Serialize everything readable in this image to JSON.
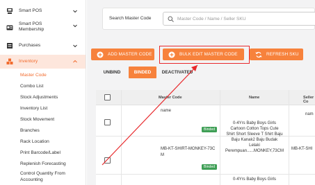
{
  "sidebar": {
    "items": [
      {
        "label": "Smart POS",
        "icon": "pos-terminal-icon"
      },
      {
        "label": "Smart POS Membership",
        "label_line1": "Smart POS",
        "label_line2": "Membership",
        "icon": "membership-card-icon"
      },
      {
        "label": "Purchases",
        "icon": "purchases-icon"
      },
      {
        "label": "Inventory",
        "icon": "inventory-boxes-icon"
      }
    ],
    "inventory_subitems": [
      "Master Code",
      "Combo List",
      "Stock Adjustments",
      "Inventory List",
      "Stock Movement",
      "Branches",
      "Rack Location",
      "Print Barcode/Label",
      "Replenish Forecasting",
      "Control Quantity From",
      "Accounting"
    ]
  },
  "search": {
    "label": "Search Master Code",
    "placeholder": "Master Code / Name / Seller SKU"
  },
  "toolbar": {
    "add_label": "ADD MASTER CODE",
    "bulk_edit_label": "BULK EDIT MASTER CODE",
    "refresh_label": "REFRESH SKU"
  },
  "tabs": [
    {
      "label": "UNBIND",
      "active": false
    },
    {
      "label": "BINDED",
      "active": true
    },
    {
      "label": "DEACTIVATED",
      "active": false
    }
  ],
  "table": {
    "headers": [
      "Master Code",
      "Name",
      "Seller Co"
    ],
    "rows": [
      {
        "master_code": "",
        "name": "name",
        "seller_code": "nam",
        "badge": "Binded"
      },
      {
        "master_code_line1": "MB-KT-SHIRT-MONKEY-73C",
        "master_code_line2": "M",
        "name_lines": [
          "0-4Yrs Baby Boys Girls",
          "Cartoon Cotton Tops Cute",
          "Shirt Short Sleeve T Shirt Baju",
          "Baju Kanak2 Baju Budak",
          "Lelaki",
          "Perempuan......MONKEY,73CM"
        ],
        "seller_code": "MB-KT-SHI",
        "badge": "Binded"
      },
      {
        "name_lines": [
          "0-4Yrs Baby Boys Girls"
        ]
      }
    ]
  },
  "colors": {
    "accent": "#f7823c",
    "active_nav_bg": "#fde6dc",
    "highlight": "#e8282b",
    "badge_green": "#3f9f56"
  }
}
